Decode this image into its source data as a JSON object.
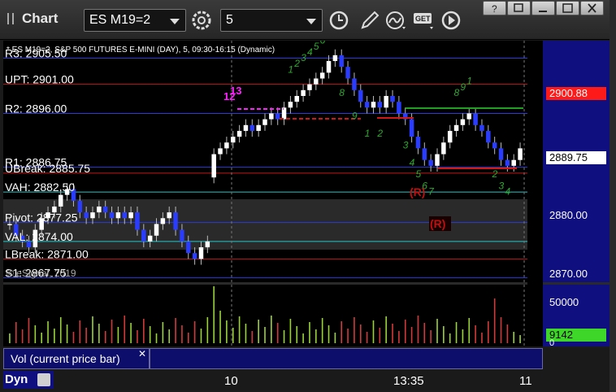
{
  "toolbar": {
    "app_title": "Chart",
    "symbol": "ES M19=2",
    "interval": "5",
    "icons": [
      "settings-gear-icon",
      "clock-icon",
      "pencil-draw-icon",
      "study-wave-icon",
      "get-data-icon",
      "play-icon"
    ]
  },
  "chart": {
    "header": "* ES M19=2, S&P 500 FUTURES E-MINI (DAY), 5, 09:30-16:15 (Dynamic)",
    "watermark": "© eSignal, 2019",
    "levels": [
      {
        "label": "R3: 2905.50",
        "price": 2905.5,
        "color": "#2b3bd8"
      },
      {
        "label": "UPT: 2901.00",
        "price": 2901.0,
        "color": "#c01818"
      },
      {
        "label": "R2: 2896.00",
        "price": 2896.0,
        "color": "#2b3bd8"
      },
      {
        "label": "R1: 2886.75",
        "price": 2886.75,
        "color": "#2b3bd8"
      },
      {
        "label": "UBreak: 2885.75",
        "price": 2885.75,
        "color": "#c01818"
      },
      {
        "label": "VAH: 2882.50",
        "price": 2882.5,
        "color": "#20c8c8"
      },
      {
        "label": "Pivot: 2877.25",
        "price": 2877.25,
        "color": "#2b3bd8"
      },
      {
        "label": "VAL: 2874.00",
        "price": 2874.0,
        "color": "#20c8c8"
      },
      {
        "label": "LBreak: 2871.00",
        "price": 2871.0,
        "color": "#c01818"
      },
      {
        "label": "S1: 2867.75",
        "price": 2867.75,
        "color": "#2b3bd8"
      }
    ],
    "markers": {
      "r_upper": "(R)",
      "r_lower": "(R)",
      "magenta_a": "13",
      "magenta_b": "12"
    },
    "price_axis": {
      "ticks": [
        "2880.00",
        "2870.00"
      ],
      "tag_upt": "2900.88",
      "tag_last": "2889.75"
    },
    "volume": {
      "legend": "Vol (current price bar)",
      "axis_tick": "50000",
      "axis_zero": "0",
      "last_value": "9142"
    },
    "time_axis": [
      "10",
      "13:35",
      "11"
    ],
    "dyn_label": "Dyn"
  },
  "colors": {
    "up_bar": "#ffffff",
    "down_bar": "#2a3dff",
    "tag_red": "#ff1a1a",
    "tag_green": "#3fd62a",
    "td_green": "#2fa82f",
    "magenta": "#ff20ff"
  },
  "chart_data": {
    "type": "candlestick",
    "price_range": [
      2867.0,
      2908.5
    ],
    "closes": [
      2877,
      2875,
      2874,
      2873,
      2876,
      2878,
      2879,
      2880,
      2882,
      2883,
      2881,
      2879,
      2878,
      2879,
      2880,
      2879,
      2878,
      2879,
      2878,
      2879,
      2876,
      2874,
      2875,
      2877,
      2878,
      2879,
      2876,
      2874,
      2872,
      2871,
      2873,
      2874,
      2889,
      2890,
      2891,
      2892,
      2893,
      2894,
      2893,
      2894,
      2895,
      2896,
      2895,
      2897,
      2898,
      2899,
      2900,
      2901,
      2902,
      2903,
      2905,
      2906,
      2904,
      2902,
      2900,
      2898,
      2897,
      2898,
      2897,
      2899,
      2898,
      2896,
      2895,
      2892,
      2890,
      2888,
      2887,
      2889,
      2891,
      2893,
      2894,
      2895,
      2896,
      2894,
      2893,
      2891,
      2890,
      2888,
      2887,
      2888,
      2890
    ]
  }
}
